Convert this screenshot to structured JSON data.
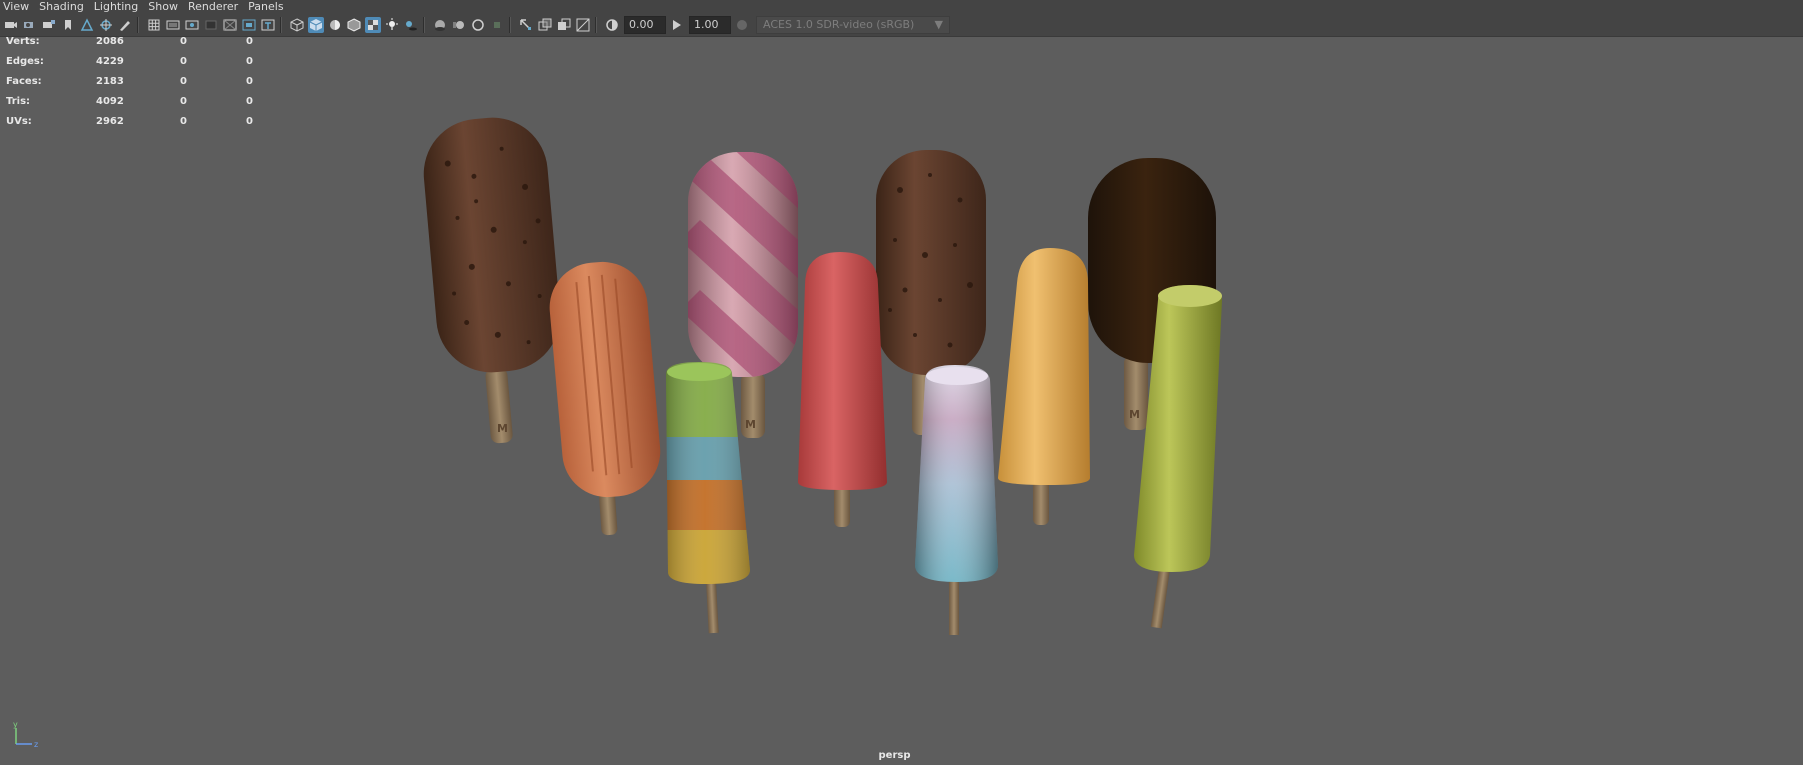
{
  "menu": [
    "View",
    "Shading",
    "Lighting",
    "Show",
    "Renderer",
    "Panels"
  ],
  "toolbar": {
    "exposure": "0.00",
    "gamma": "1.00",
    "color_space": "ACES 1.0 SDR-video (sRGB)"
  },
  "hud": {
    "rows": [
      {
        "label": "Verts:",
        "v1": "2086",
        "v2": "0",
        "v3": "0"
      },
      {
        "label": "Edges:",
        "v1": "4229",
        "v2": "0",
        "v3": "0"
      },
      {
        "label": "Faces:",
        "v1": "2183",
        "v2": "0",
        "v3": "0"
      },
      {
        "label": "Tris:",
        "v1": "4092",
        "v2": "0",
        "v3": "0"
      },
      {
        "label": "UVs:",
        "v1": "2962",
        "v2": "0",
        "v3": "0"
      }
    ]
  },
  "viewport": {
    "camera": "persp",
    "axis_y": "y",
    "axis_z": "z",
    "stick_stamp": "M"
  }
}
